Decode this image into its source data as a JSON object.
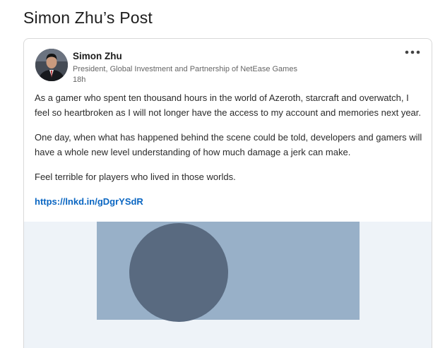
{
  "page": {
    "title": "Simon Zhu’s Post"
  },
  "post": {
    "author": {
      "name": "Simon Zhu",
      "headline": "President, Global Investment and Partnership of NetEase Games",
      "time": "18h"
    },
    "more_icon": "more-horizontal-icon",
    "paragraphs": [
      "As a gamer who spent ten thousand hours in the world of Azeroth, starcraft and overwatch, I feel so heartbroken as I will not longer have the access to my account and memories next year.",
      "One day, when what has happened behind the scene could be told, developers and gamers will have a whole new level understanding of how much damage a jerk can make.",
      "Feel terrible for players who lived in those worlds."
    ],
    "link": "https://lnkd.in/gDgrYSdR"
  },
  "colors": {
    "link": "#0a66c2",
    "media_background": "#98b0c8",
    "media_circle": "#596a80"
  }
}
